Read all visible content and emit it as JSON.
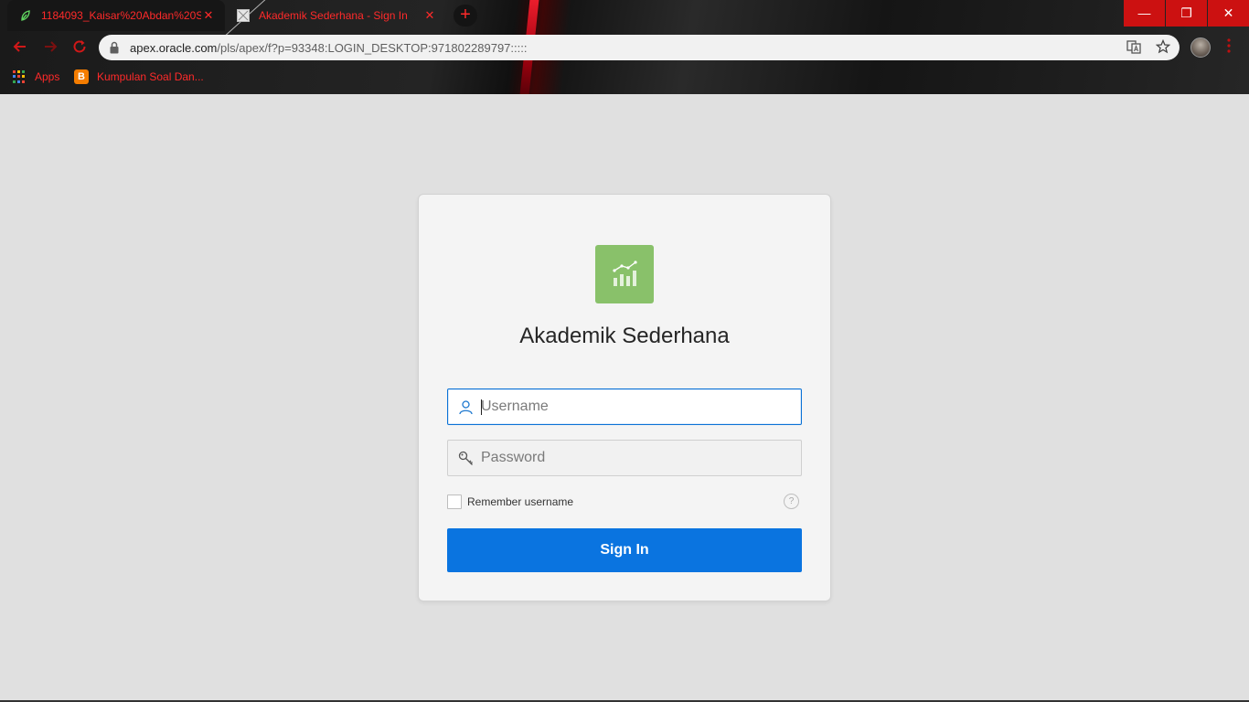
{
  "browser": {
    "tabs": [
      {
        "title": "1184093_Kaisar%20Abdan%20S",
        "active": true,
        "favicon": "leaf-icon"
      },
      {
        "title": "Akademik Sederhana - Sign In",
        "active": false,
        "favicon": "page-icon"
      }
    ],
    "close_glyph": "✕",
    "new_tab_glyph": "+",
    "url_host": "apex.oracle.com",
    "url_path": "/pls/apex/f?p=93348:LOGIN_DESKTOP:971802289797:::::",
    "bookmarks": [
      {
        "label": "Apps",
        "icon": "apps-grid-icon"
      },
      {
        "label": "Kumpulan Soal Dan...",
        "icon": "blogger-icon"
      }
    ],
    "window_controls": {
      "minimize": "—",
      "restore": "❐",
      "close": "✕"
    }
  },
  "login": {
    "app_title": "Akademik Sederhana",
    "username_placeholder": "Username",
    "password_placeholder": "Password",
    "remember_label": "Remember username",
    "help_glyph": "?",
    "signin_label": "Sign In"
  },
  "colors": {
    "accent": "#0a74e0",
    "logo_bg": "#89c16a",
    "chrome_red": "#ff2a2a"
  }
}
